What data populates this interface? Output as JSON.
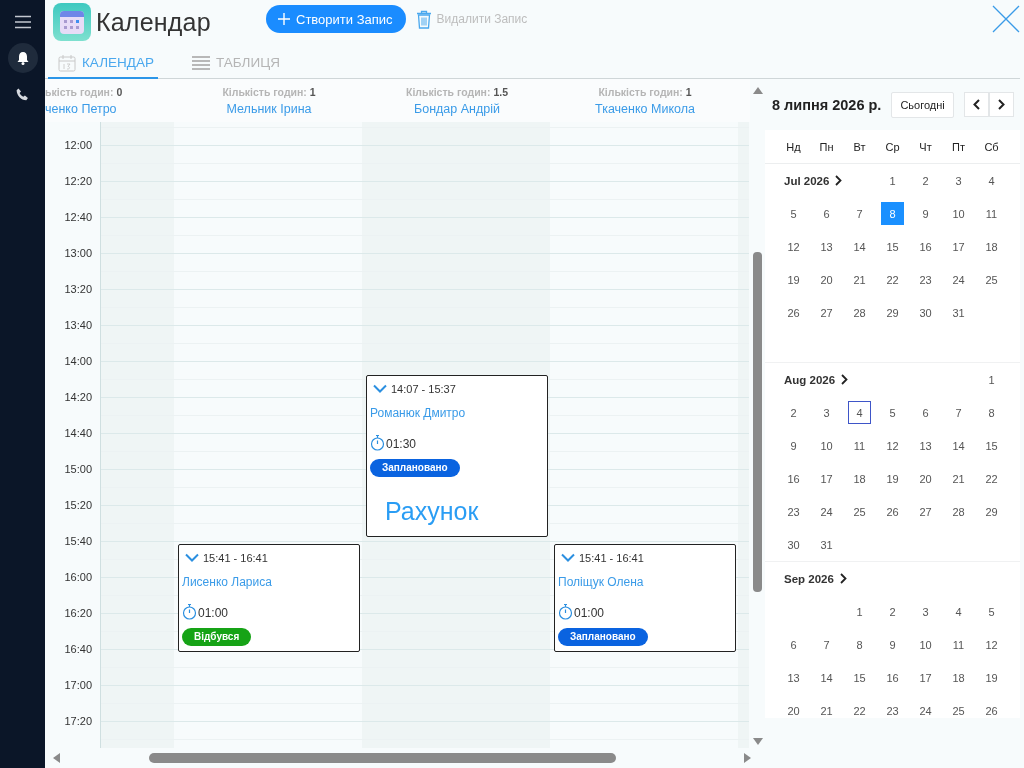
{
  "sidebar": {
    "items": [
      {
        "kind": "menu",
        "selected": false
      },
      {
        "kind": "bell",
        "selected": true
      },
      {
        "kind": "phone",
        "selected": false
      }
    ]
  },
  "title": "Календар",
  "actions": [
    {
      "kind": "create",
      "label": "Створити Запис",
      "disabled": false
    },
    {
      "kind": "delete",
      "label": "Видалити Запис",
      "disabled": true
    }
  ],
  "tabs": [
    {
      "kind": "calendar",
      "label": "КАЛЕНДАР",
      "selected": true
    },
    {
      "kind": "table",
      "label": "ТАБЛИЦЯ",
      "selected": false
    }
  ],
  "times": [
    "12:00",
    "12:20",
    "12:40",
    "13:00",
    "13:20",
    "13:40",
    "14:00",
    "14:20",
    "14:40",
    "15:00",
    "15:20",
    "15:40",
    "16:00",
    "16:20",
    "16:40",
    "17:00",
    "17:20"
  ],
  "columns": [
    {
      "hours": "ькість годин: **0**",
      "name": "ченко Петро"
    },
    {
      "hours": "Кількість годин: **1**",
      "name": "Мельник Ірина",
      "events": [
        {
          "time": "15:41 - 16:41",
          "client": "Лисенко Лариса",
          "duration": "01:00",
          "status": {
            "kind": "done",
            "label": "Відбувся"
          }
        }
      ]
    },
    {
      "hours": "Кількість годин: **1.5**",
      "name": "Бондар Андрій",
      "events": [
        {
          "time": "14:07 - 15:37",
          "client": "Романюк Дмитро",
          "duration": "01:30",
          "status": {
            "kind": "planned",
            "label": "Заплановано"
          },
          "link": "Рахунок"
        }
      ]
    },
    {
      "hours": "Кількість годин: **1**",
      "name": "Ткаченко Микола",
      "events": [
        {
          "time": "15:41 - 16:41",
          "client": "Поліщук Олена",
          "duration": "01:00",
          "status": {
            "kind": "planned",
            "label": "Заплановано"
          }
        }
      ]
    }
  ],
  "date_title": "8 липня 2026 р.",
  "today_button": "Сьогодні",
  "weekdays": [
    "Нд",
    "Пн",
    "Вт",
    "Ср",
    "Чт",
    "Пт",
    "Сб"
  ],
  "months": [
    {
      "label": "Jul 2026",
      "weeks": [
        [
          {
            "day": "1",
            "selected": false,
            "focused": false
          },
          {
            "day": "2",
            "selected": false,
            "focused": false
          },
          {
            "day": "3",
            "selected": false,
            "focused": false
          },
          {
            "day": "4",
            "selected": false,
            "focused": false
          }
        ],
        [
          {
            "day": "5",
            "selected": false,
            "focused": false
          },
          {
            "day": "6",
            "selected": false,
            "focused": false
          },
          {
            "day": "7",
            "selected": false,
            "focused": false
          },
          {
            "day": "8",
            "selected": true,
            "focused": false
          },
          {
            "day": "9",
            "selected": false,
            "focused": false
          },
          {
            "day": "10",
            "selected": false,
            "focused": false
          },
          {
            "day": "11",
            "selected": false,
            "focused": false
          }
        ],
        [
          {
            "day": "12",
            "selected": false,
            "focused": false
          },
          {
            "day": "13",
            "selected": false,
            "focused": false
          },
          {
            "day": "14",
            "selected": false,
            "focused": false
          },
          {
            "day": "15",
            "selected": false,
            "focused": false
          },
          {
            "day": "16",
            "selected": false,
            "focused": false
          },
          {
            "day": "17",
            "selected": false,
            "focused": false
          },
          {
            "day": "18",
            "selected": false,
            "focused": false
          }
        ],
        [
          {
            "day": "19",
            "selected": false,
            "focused": false
          },
          {
            "day": "20",
            "selected": false,
            "focused": false
          },
          {
            "day": "21",
            "selected": false,
            "focused": false
          },
          {
            "day": "22",
            "selected": false,
            "focused": false
          },
          {
            "day": "23",
            "selected": false,
            "focused": false
          },
          {
            "day": "24",
            "selected": false,
            "focused": false
          },
          {
            "day": "25",
            "selected": false,
            "focused": false
          }
        ],
        [
          {
            "day": "26",
            "selected": false,
            "focused": false
          },
          {
            "day": "27",
            "selected": false,
            "focused": false
          },
          {
            "day": "28",
            "selected": false,
            "focused": false
          },
          {
            "day": "29",
            "selected": false,
            "focused": false
          },
          {
            "day": "30",
            "selected": false,
            "focused": false
          },
          {
            "day": "31",
            "selected": false,
            "focused": false
          }
        ]
      ]
    },
    {
      "label": "Aug 2026",
      "weeks": [
        [
          {
            "day": "1",
            "selected": false,
            "focused": false
          }
        ],
        [
          {
            "day": "2",
            "selected": false,
            "focused": false
          },
          {
            "day": "3",
            "selected": false,
            "focused": false
          },
          {
            "day": "4",
            "selected": false,
            "focused": true
          },
          {
            "day": "5",
            "selected": false,
            "focused": false
          },
          {
            "day": "6",
            "selected": false,
            "focused": false
          },
          {
            "day": "7",
            "selected": false,
            "focused": false
          },
          {
            "day": "8",
            "selected": false,
            "focused": false
          }
        ],
        [
          {
            "day": "9",
            "selected": false,
            "focused": false
          },
          {
            "day": "10",
            "selected": false,
            "focused": false
          },
          {
            "day": "11",
            "selected": false,
            "focused": false
          },
          {
            "day": "12",
            "selected": false,
            "focused": false
          },
          {
            "day": "13",
            "selected": false,
            "focused": false
          },
          {
            "day": "14",
            "selected": false,
            "focused": false
          },
          {
            "day": "15",
            "selected": false,
            "focused": false
          }
        ],
        [
          {
            "day": "16",
            "selected": false,
            "focused": false
          },
          {
            "day": "17",
            "selected": false,
            "focused": false
          },
          {
            "day": "18",
            "selected": false,
            "focused": false
          },
          {
            "day": "19",
            "selected": false,
            "focused": false
          },
          {
            "day": "20",
            "selected": false,
            "focused": false
          },
          {
            "day": "21",
            "selected": false,
            "focused": false
          },
          {
            "day": "22",
            "selected": false,
            "focused": false
          }
        ],
        [
          {
            "day": "23",
            "selected": false,
            "focused": false
          },
          {
            "day": "24",
            "selected": false,
            "focused": false
          },
          {
            "day": "25",
            "selected": false,
            "focused": false
          },
          {
            "day": "26",
            "selected": false,
            "focused": false
          },
          {
            "day": "27",
            "selected": false,
            "focused": false
          },
          {
            "day": "28",
            "selected": false,
            "focused": false
          },
          {
            "day": "29",
            "selected": false,
            "focused": false
          }
        ],
        [
          {
            "day": "30",
            "selected": false,
            "focused": false
          },
          {
            "day": "31",
            "selected": false,
            "focused": false
          }
        ]
      ]
    },
    {
      "label": "Sep 2026",
      "weeks": [
        [
          {
            "day": "1",
            "selected": false,
            "focused": false
          },
          {
            "day": "2",
            "selected": false,
            "focused": false
          },
          {
            "day": "3",
            "selected": false,
            "focused": false
          },
          {
            "day": "4",
            "selected": false,
            "focused": false
          },
          {
            "day": "5",
            "selected": false,
            "focused": false
          }
        ],
        [
          {
            "day": "6",
            "selected": false,
            "focused": false
          },
          {
            "day": "7",
            "selected": false,
            "focused": false
          },
          {
            "day": "8",
            "selected": false,
            "focused": false
          },
          {
            "day": "9",
            "selected": false,
            "focused": false
          },
          {
            "day": "10",
            "selected": false,
            "focused": false
          },
          {
            "day": "11",
            "selected": false,
            "focused": false
          },
          {
            "day": "12",
            "selected": false,
            "focused": false
          }
        ],
        [
          {
            "day": "13",
            "selected": false,
            "focused": false
          },
          {
            "day": "14",
            "selected": false,
            "focused": false
          },
          {
            "day": "15",
            "selected": false,
            "focused": false
          },
          {
            "day": "16",
            "selected": false,
            "focused": false
          },
          {
            "day": "17",
            "selected": false,
            "focused": false
          },
          {
            "day": "18",
            "selected": false,
            "focused": false
          },
          {
            "day": "19",
            "selected": false,
            "focused": false
          }
        ],
        [
          {
            "day": "20",
            "selected": false,
            "focused": false
          },
          {
            "day": "21",
            "selected": false,
            "focused": false
          },
          {
            "day": "22",
            "selected": false,
            "focused": false
          },
          {
            "day": "23",
            "selected": false,
            "focused": false
          },
          {
            "day": "24",
            "selected": false,
            "focused": false
          },
          {
            "day": "25",
            "selected": false,
            "focused": false
          },
          {
            "day": "26",
            "selected": false,
            "focused": false
          }
        ]
      ]
    }
  ]
}
